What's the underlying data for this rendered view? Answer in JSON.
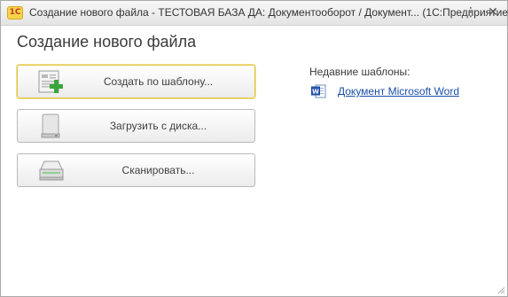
{
  "window": {
    "title": "Создание нового файла - ТЕСТОВАЯ БАЗА ДА: Документооборот / Документ... (1С:Предприятие)",
    "logo_text": "1С"
  },
  "heading": "Создание нового файла",
  "buttons": [
    {
      "label": "Создать по шаблону...",
      "icon": "template-add-icon"
    },
    {
      "label": "Загрузить с диска...",
      "icon": "disk-drive-icon"
    },
    {
      "label": "Сканировать...",
      "icon": "scanner-icon"
    }
  ],
  "recent": {
    "label": "Недавние шаблоны:",
    "items": [
      {
        "label": "Документ Microsoft Word",
        "icon": "word-document-icon"
      }
    ]
  },
  "colors": {
    "link": "#1c4fa8",
    "focus_border": "#e0c64a",
    "logo_bg": "#f6d44a"
  }
}
